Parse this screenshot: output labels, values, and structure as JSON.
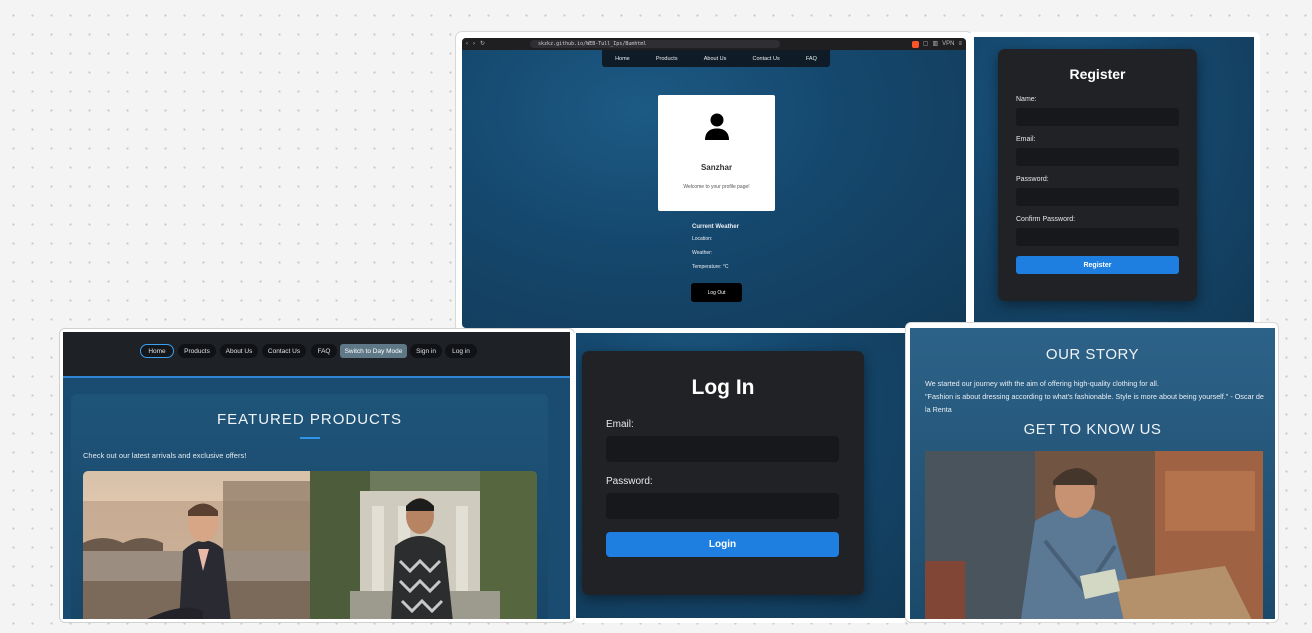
{
  "profile_card": {
    "url": "skzkz.github.io/WEB-Tull_Ips/Bumhtml",
    "nav": [
      "Home",
      "Products",
      "About Us",
      "Contact Us",
      "FAQ"
    ],
    "user_name": "Sanzhar",
    "welcome": "Welcome to your profile page!",
    "weather": {
      "title": "Current Weather",
      "location": "Location:",
      "weather": "Weather:",
      "temperature": "Temperature: °C"
    },
    "logout_label": "Log Out",
    "browser_icons": {
      "back": "‹",
      "forward": "›",
      "reload": "↻",
      "vpn": "VPN"
    }
  },
  "register_card": {
    "title": "Register",
    "fields": [
      "Name:",
      "Email:",
      "Password:",
      "Confirm Password:"
    ],
    "button": "Register"
  },
  "featured_card": {
    "nav": [
      "Home",
      "Products",
      "About Us",
      "Contact Us",
      "FAQ",
      "Switch to Day Mode",
      "Sign in",
      "Log in"
    ],
    "title": "FEATURED PRODUCTS",
    "subtitle": "Check out our latest arrivals and exclusive offers!"
  },
  "login_card": {
    "title": "Log In",
    "email_label": "Email:",
    "password_label": "Password:",
    "button": "Login"
  },
  "story_card": {
    "title": "OUR STORY",
    "line1": "We started our journey with the aim of offering high-quality clothing for all.",
    "quote": "\"Fashion is about dressing according to what's fashionable. Style is more about being yourself.\" - Oscar de la Renta",
    "know_title": "GET TO KNOW US"
  },
  "colors": {
    "accent_blue": "#1e7fe0",
    "panel_dark": "#212226",
    "page_blue": "#15476d",
    "sparkle": "#f5c518"
  }
}
